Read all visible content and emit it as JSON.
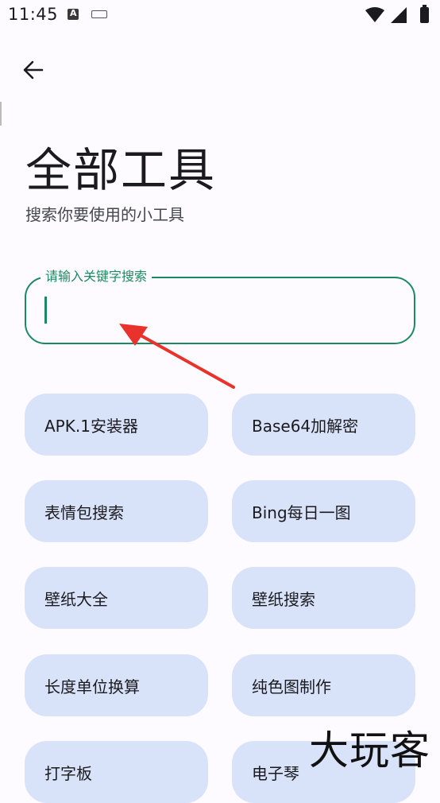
{
  "status_bar": {
    "time": "11:45",
    "icons": [
      "accessibility-a-icon",
      "keyboard-icon",
      "wifi-icon",
      "signal-icon",
      "battery-icon"
    ]
  },
  "header": {
    "back_icon": "arrow-left-icon",
    "title": "全部工具",
    "subtitle": "搜索你要使用的小工具"
  },
  "search": {
    "label": "请输入关键字搜索",
    "value": "",
    "accent_color": "#1b8a5f"
  },
  "tools": [
    {
      "label": "APK.1安装器"
    },
    {
      "label": "Base64加解密"
    },
    {
      "label": "表情包搜索"
    },
    {
      "label": "Bing每日一图"
    },
    {
      "label": "壁纸大全"
    },
    {
      "label": "壁纸搜索"
    },
    {
      "label": "长度单位换算"
    },
    {
      "label": "纯色图制作"
    },
    {
      "label": "打字板"
    },
    {
      "label": "电子琴"
    }
  ],
  "watermark": "大玩客",
  "colors": {
    "chip_background": "#d8e2f9",
    "annotation_arrow": "#e8322b"
  }
}
